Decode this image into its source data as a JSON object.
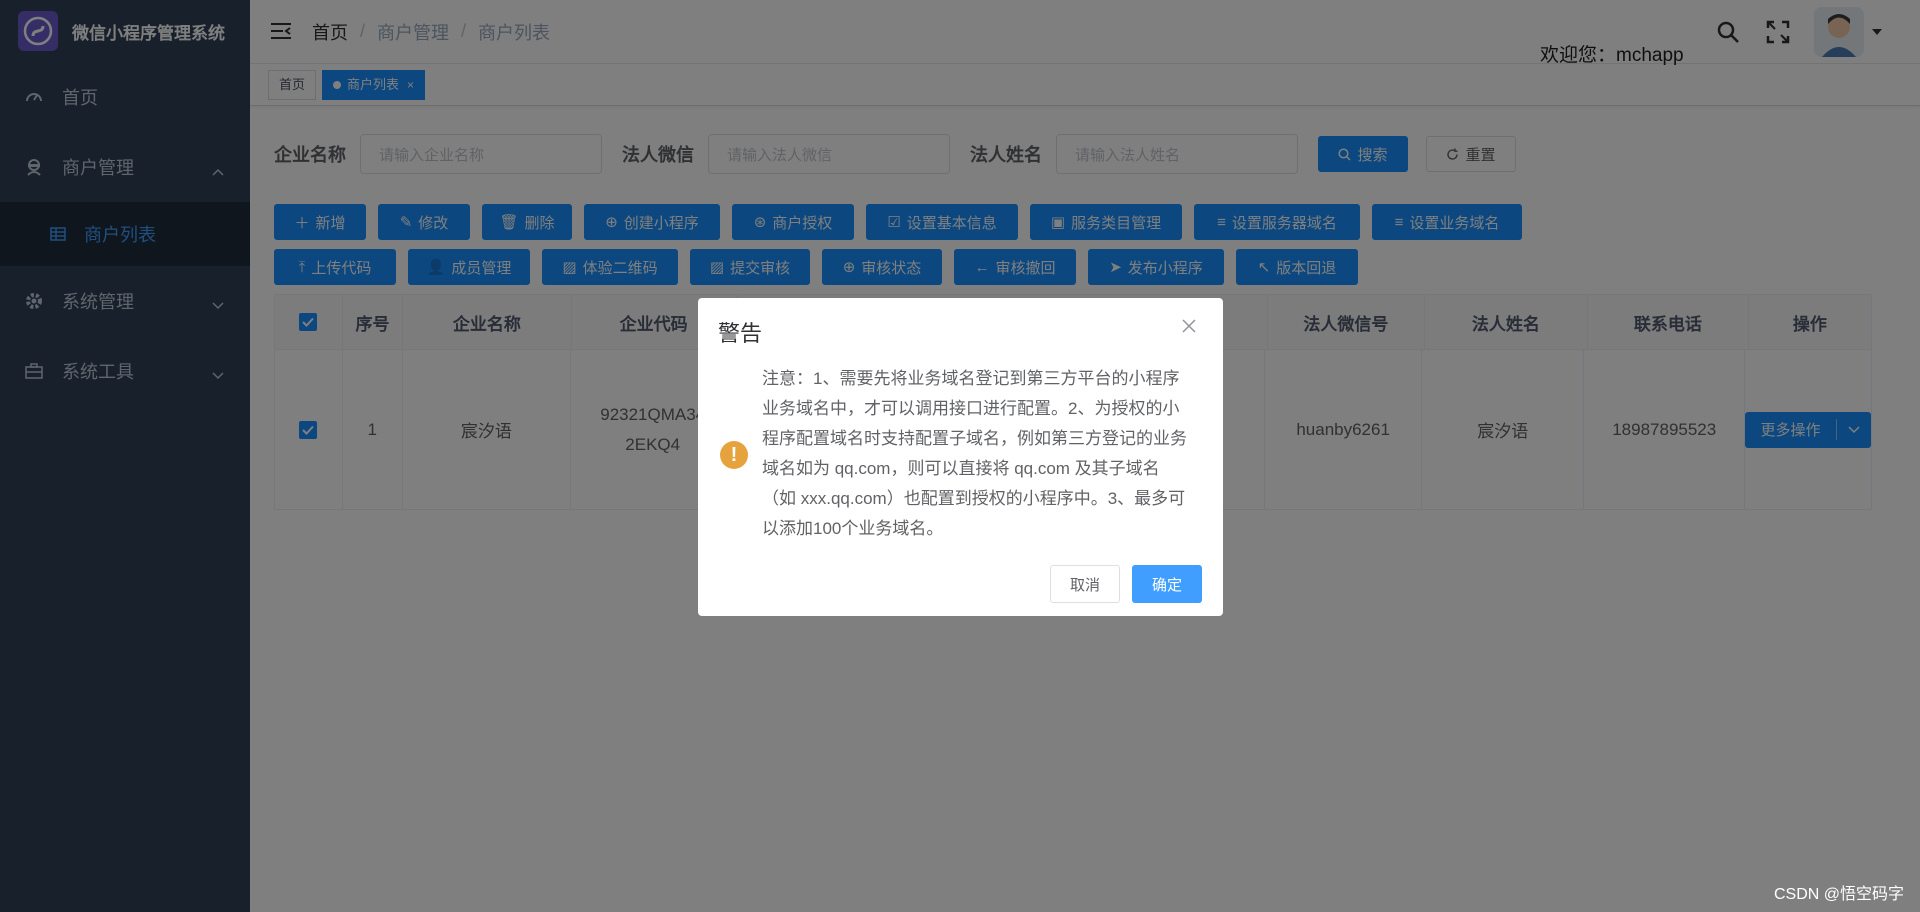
{
  "app": {
    "title": "微信小程序管理系统",
    "logo_glyph": "ℰ"
  },
  "sidebar": {
    "items": [
      {
        "label": "首页",
        "icon": "dashboard-icon"
      },
      {
        "label": "商户管理",
        "icon": "merchant-icon",
        "expanded": true,
        "children": [
          {
            "label": "商户列表",
            "icon": "table-icon",
            "active": true
          }
        ]
      },
      {
        "label": "系统管理",
        "icon": "gear-icon"
      },
      {
        "label": "系统工具",
        "icon": "toolbox-icon"
      }
    ]
  },
  "navbar": {
    "breadcrumb": [
      "首页",
      "商户管理",
      "商户列表"
    ],
    "breadcrumb_sep": "/",
    "welcome": "欢迎您：mchapp"
  },
  "tags": [
    {
      "label": "首页",
      "active": false
    },
    {
      "label": "商户列表",
      "active": true,
      "close": "×"
    }
  ],
  "search": {
    "fields": [
      {
        "label": "企业名称",
        "placeholder": "请输入企业名称"
      },
      {
        "label": "法人微信",
        "placeholder": "请输入法人微信"
      },
      {
        "label": "法人姓名",
        "placeholder": "请输入法人姓名"
      }
    ],
    "search_label": "搜索",
    "reset_label": "重置"
  },
  "toolbar": {
    "row1": [
      "新增",
      "修改",
      "删除",
      "创建小程序",
      "商户授权",
      "设置基本信息",
      "服务类目管理",
      "设置服务器域名",
      "设置业务域名"
    ],
    "row2": [
      "上传代码",
      "成员管理",
      "体验二维码",
      "提交审核",
      "审核状态",
      "审核撤回",
      "发布小程序",
      "版本回退"
    ]
  },
  "table": {
    "columns": [
      "序号",
      "企业名称",
      "企业代码",
      "法人微信号",
      "法人姓名",
      "联系电话",
      "操作"
    ],
    "rows": [
      {
        "index": "1",
        "company": "宸汐语",
        "code_line1": "92321QMA34",
        "code_line2": "2EKQ4",
        "wechat": "huanby6261",
        "legal_name": "宸汐语",
        "phone": "18987895523",
        "action": "更多操作"
      }
    ]
  },
  "dialog": {
    "title": "警告",
    "message": "注意：1、需要先将业务域名登记到第三方平台的小程序业务域名中，才可以调用接口进行配置。2、为授权的小程序配置域名时支持配置子域名，例如第三方登记的业务域名如为 qq.com，则可以直接将 qq.com 及其子域名（如 xxx.qq.com）也配置到授权的小程序中。3、最多可以添加100个业务域名。",
    "cancel": "取消",
    "confirm": "确定"
  },
  "watermark": "CSDN @悟空码字",
  "colors": {
    "sidebar": "#304156",
    "primary": "#1890ff",
    "warning": "#e6a23c"
  }
}
